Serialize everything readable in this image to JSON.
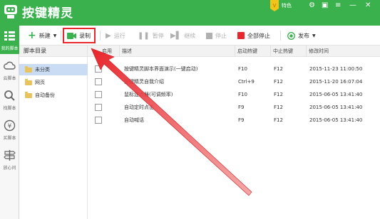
{
  "app": {
    "title": "按键精灵",
    "vip_label": "特色"
  },
  "nav": [
    {
      "label": "我的脚本",
      "icon": "menu-icon",
      "active": true
    },
    {
      "label": "云脚本",
      "icon": "cloud-icon",
      "active": false
    },
    {
      "label": "找脚本",
      "icon": "search-icon",
      "active": false
    },
    {
      "label": "买脚本",
      "icon": "money-icon",
      "active": false
    },
    {
      "label": "放心问",
      "icon": "signpost-icon",
      "active": false
    }
  ],
  "toolbar": {
    "new_label": "新建",
    "record_label": "录制",
    "run_label": "运行",
    "pause_label": "暂停",
    "resume_label": "继续",
    "stop_label": "停止",
    "stop_all_label": "全部停止",
    "publish_label": "发布"
  },
  "tree": {
    "header": "脚本目录",
    "items": [
      "未分类",
      "网页",
      "自动备份"
    ]
  },
  "table": {
    "headers": [
      "启用",
      "描述",
      "启动热键",
      "中止热键",
      "修改时间"
    ],
    "rows": [
      {
        "desc": "按键精灵脚本界面演示(一键启动)",
        "start": "F10",
        "stop": "F12",
        "time": "2015-11-23 11:00:50"
      },
      {
        "desc": "按键精灵自我介绍",
        "start": "Ctrl+9",
        "stop": "F12",
        "time": "2015-11-20 16:07:04"
      },
      {
        "desc": "鼠标连点器(可调频率)",
        "start": "F10",
        "stop": "F12",
        "time": "2015-06-05 13:41:40"
      },
      {
        "desc": "自动定时点击",
        "start": "F9",
        "stop": "F12",
        "time": "2015-06-05 13:41:40"
      },
      {
        "desc": "自动喊话",
        "start": "F9",
        "stop": "F12",
        "time": "2015-06-05 13:41:40"
      }
    ]
  },
  "colors": {
    "brand_green": "#3ab14d",
    "highlight_red": "#e8262c",
    "selection_blue": "#c9dcf4"
  }
}
